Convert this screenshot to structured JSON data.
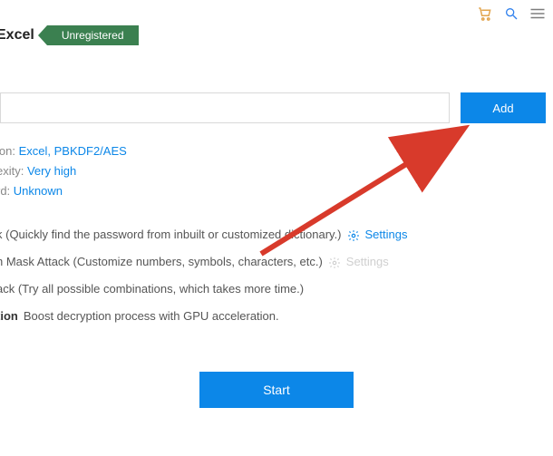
{
  "topbar": {
    "cart": "cart",
    "search": "search",
    "menu": "menu"
  },
  "header": {
    "title": "Excel",
    "badge": "Unregistered"
  },
  "file": {
    "path": "",
    "add_label": "Add"
  },
  "details": {
    "encryption_label": "ion:",
    "encryption_value": "Excel, PBKDF2/AES",
    "complexity_label": "exity:",
    "complexity_value": "Very high",
    "password_label": "rd:",
    "password_value": "Unknown"
  },
  "attacks": {
    "dictionary": "k (Quickly find the password from inbuilt or customized dictionary.)",
    "dictionary_settings": "Settings",
    "mask": "h Mask Attack (Customize numbers, symbols, characters, etc.)",
    "mask_settings": "Settings",
    "brute": "ack (Try all possible combinations, which takes more time.)",
    "gpu_bold": "tion",
    "gpu_rest": "Boost decryption process with GPU acceleration."
  },
  "actions": {
    "start": "Start"
  },
  "colors": {
    "accent": "#0c87e8",
    "badge_bg": "#3b8050",
    "cart": "#e2a54e",
    "search": "#2f80ed",
    "menu": "#7d7d7d",
    "arrow": "#d83a2b"
  }
}
